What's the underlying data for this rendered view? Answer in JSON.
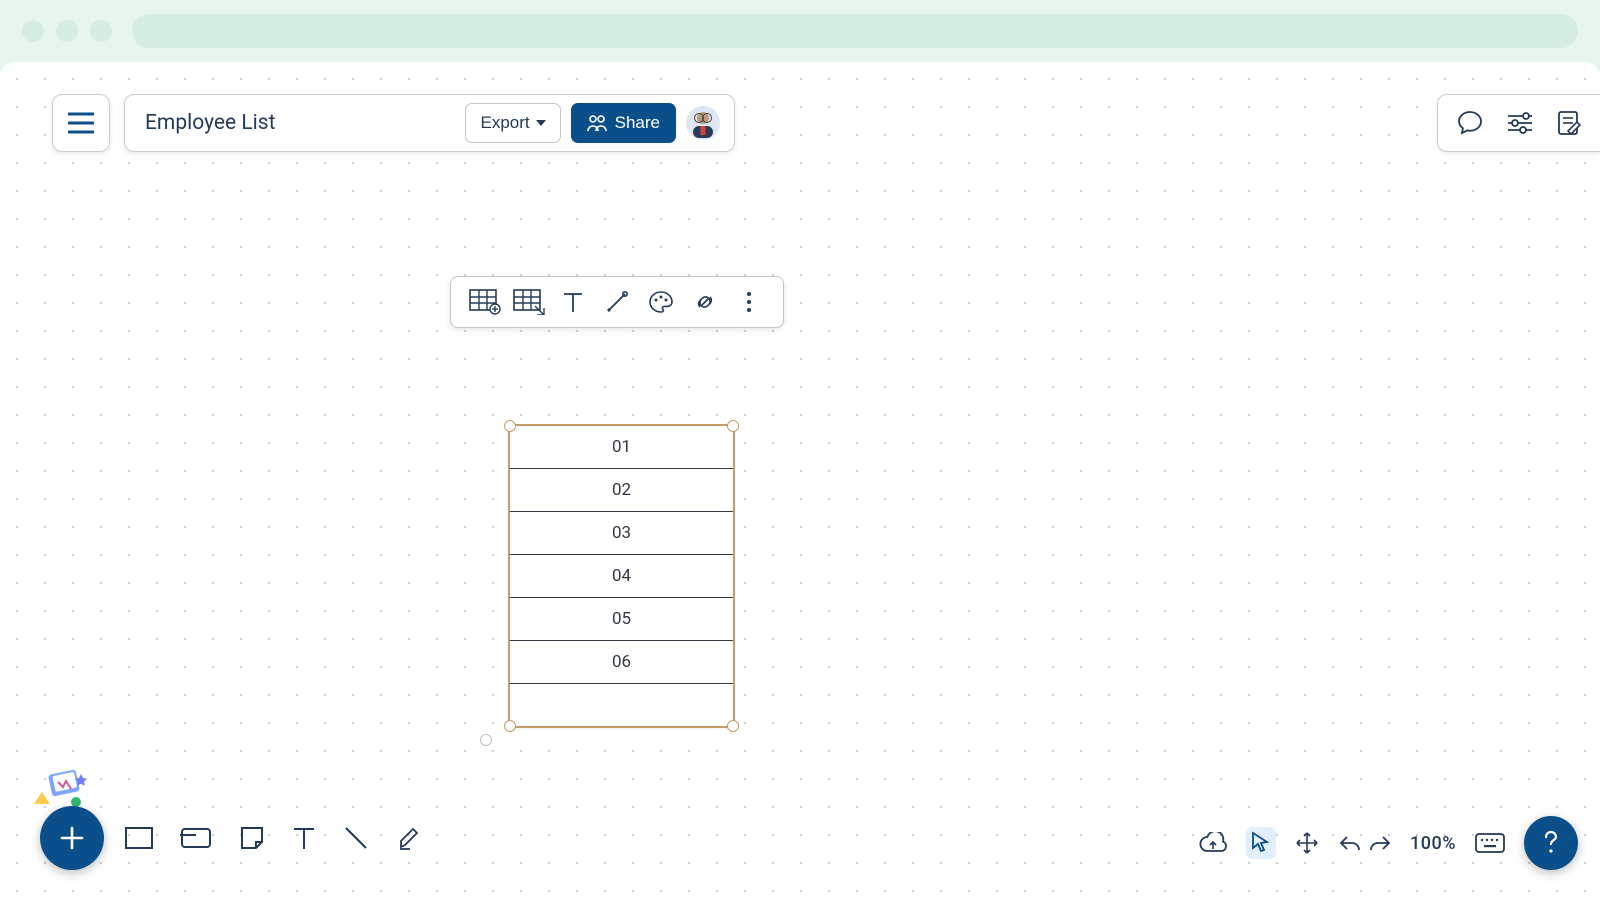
{
  "header": {
    "title": "Employee List",
    "export_label": "Export",
    "share_label": "Share"
  },
  "table": {
    "rows": [
      "01",
      "02",
      "03",
      "04",
      "05",
      "06",
      ""
    ]
  },
  "bottomRight": {
    "zoom": "100%"
  },
  "icons": {
    "hamburger": "menu-icon",
    "people": "people-icon",
    "avatar": "avatar",
    "comment": "comment-icon",
    "sliders": "sliders-icon",
    "edit": "edit-note-icon",
    "tableAddCell": "table-add-cell-icon",
    "tableSub": "table-sub-icon",
    "text": "text-icon",
    "wand": "wand-icon",
    "palette": "palette-icon",
    "link": "link-icon",
    "more": "more-vertical-icon",
    "add": "plus-icon",
    "rect": "rectangle-icon",
    "rectFilled": "rectangle-filled-icon",
    "sticky": "sticky-note-icon",
    "line": "line-icon",
    "highlighter": "highlighter-icon",
    "cloud": "cloud-sync-icon",
    "cursor": "cursor-icon",
    "pan": "pan-icon",
    "undo": "undo-icon",
    "redo": "redo-icon",
    "keyboard": "keyboard-icon",
    "help": "help-icon"
  }
}
